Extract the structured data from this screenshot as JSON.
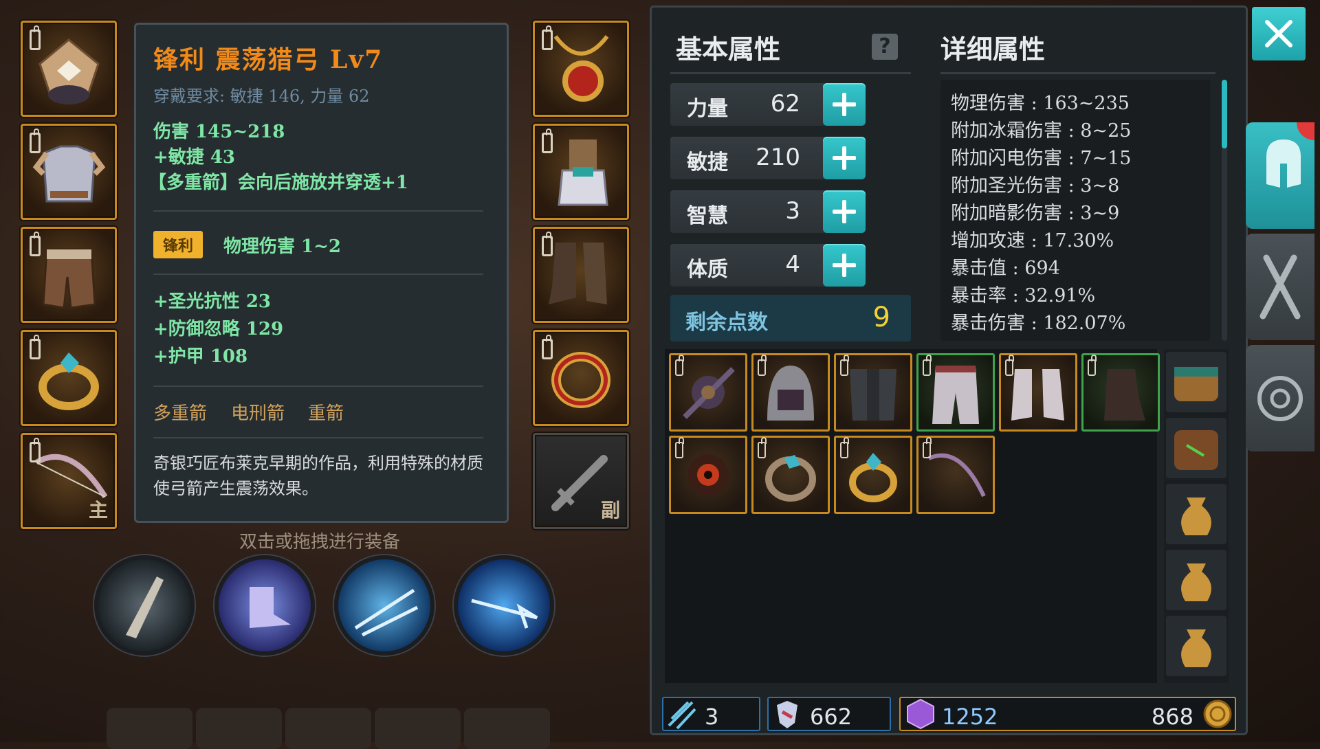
{
  "equipment_left": [
    {
      "name": "helmet"
    },
    {
      "name": "chest-armor"
    },
    {
      "name": "leggings"
    },
    {
      "name": "ring"
    },
    {
      "name": "bow",
      "tag": "主"
    }
  ],
  "equipment_right": [
    {
      "name": "necklace"
    },
    {
      "name": "gloves"
    },
    {
      "name": "boots"
    },
    {
      "name": "ring"
    },
    {
      "name": "offhand-empty",
      "tag": "副"
    }
  ],
  "tooltip": {
    "title": "锋利 震荡猎弓 Lv7",
    "requirement": "穿戴要求:  敏捷 146, 力量 62",
    "damage": "伤害  145~218",
    "agility": "+敏捷 43",
    "skill_bonus": "【多重箭】会向后施放并穿透+1",
    "affix_badge": "锋利",
    "affix_text": "物理伤害 1~2",
    "bonus1": "+圣光抗性 23",
    "bonus2": "+防御忽略 129",
    "bonus3": "+护甲 108",
    "skills": [
      "多重箭",
      "电刑箭",
      "重箭"
    ],
    "description": "奇银巧匠布莱克早期的作品，利用特殊的材质使弓箭产生震荡效果。"
  },
  "hint": "双击或拖拽进行装备",
  "skill_icons": [
    "arrow-skill",
    "dash-boot-skill",
    "ice-shot-skill",
    "lightning-arrow-skill"
  ],
  "attributes": {
    "basic_header": "基本属性",
    "detail_header": "详细属性",
    "stats": [
      {
        "name": "力量",
        "value": "62"
      },
      {
        "name": "敏捷",
        "value": "210"
      },
      {
        "name": "智慧",
        "value": "3"
      },
      {
        "name": "体质",
        "value": "4"
      }
    ],
    "remaining_label": "剩余点数",
    "remaining_value": "9",
    "details": [
      "物理伤害 : 163~235",
      "附加冰霜伤害 : 8~25",
      "附加闪电伤害 : 7~15",
      "附加圣光伤害 : 3~8",
      "附加暗影伤害 : 3~9",
      "增加攻速 : 17.30%",
      "暴击值 : 694",
      "暴击率 : 32.91%",
      "暴击伤害 : 182.07%"
    ]
  },
  "inventory": [
    {
      "name": "dark-amulet",
      "rarity": "gold"
    },
    {
      "name": "hood",
      "rarity": "gold"
    },
    {
      "name": "dark-armor",
      "rarity": "gold"
    },
    {
      "name": "white-pants",
      "rarity": "green"
    },
    {
      "name": "white-boots",
      "rarity": "gold"
    },
    {
      "name": "dark-gloves",
      "rarity": "green"
    },
    {
      "name": "eye-amulet",
      "rarity": "gold"
    },
    {
      "name": "silver-ring",
      "rarity": "gold"
    },
    {
      "name": "gem-ring",
      "rarity": "gold"
    },
    {
      "name": "bow",
      "rarity": "gold"
    }
  ],
  "bags": [
    "brown-bag",
    "green-bag",
    "sack",
    "sack",
    "sack"
  ],
  "currency": {
    "arrows": "3",
    "shards": "662",
    "gems": "1252",
    "gold": "868"
  },
  "colors": {
    "title_orange": "#f28a1a",
    "stat_green": "#7fe6a6",
    "accent_cyan": "#2bb9c2",
    "gold_border": "#c88a1e",
    "green_border": "#3fa34d",
    "remaining_yellow": "#f3d034"
  }
}
